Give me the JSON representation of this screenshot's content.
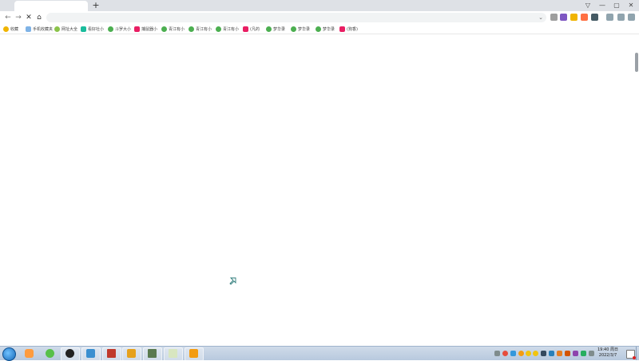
{
  "browser": {
    "new_tab_symbol": "+",
    "window_controls": {
      "shield": "▽",
      "minimize": "—",
      "maximize": "▢",
      "close": "✕"
    },
    "nav": {
      "back": "←",
      "forward": "→",
      "stop": "✕",
      "home": "⌂"
    },
    "address": {
      "value": "",
      "dropdown": "⌄"
    },
    "bookmarks": [
      {
        "label": "收藏",
        "icon": "star-icon",
        "color": "#f0b400"
      },
      {
        "label": "手机收藏夹",
        "icon": "phone-icon",
        "color": "#7fb3e6"
      },
      {
        "label": "网址大全",
        "icon": "globe-icon",
        "color": "#8bc34a"
      },
      {
        "label": "看好社小",
        "icon": "book-icon",
        "color": "#1abc9c"
      },
      {
        "label": "斗罗大小",
        "icon": "play-icon",
        "color": "#4caf50"
      },
      {
        "label": "捕鼠器小",
        "icon": "page-icon",
        "color": "#e91e63"
      },
      {
        "label": "青江有小",
        "icon": "play-icon",
        "color": "#4caf50"
      },
      {
        "label": "青江有小",
        "icon": "play-icon",
        "color": "#4caf50"
      },
      {
        "label": "青江有小",
        "icon": "play-icon",
        "color": "#4caf50"
      },
      {
        "label": "(凡的",
        "icon": "page-icon",
        "color": "#e91e63"
      },
      {
        "label": "梦华录",
        "icon": "play-icon",
        "color": "#4caf50"
      },
      {
        "label": "梦华录",
        "icon": "play-icon",
        "color": "#4caf50"
      },
      {
        "label": "梦华录",
        "icon": "play-icon",
        "color": "#4caf50"
      },
      {
        "label": "(狗香)",
        "icon": "page-icon",
        "color": "#e91e63"
      }
    ]
  },
  "taskbar": {
    "apps": [
      {
        "icon": "ie-icon",
        "color": "#ff9b3d"
      },
      {
        "icon": "360-browser-icon",
        "color": "#58c04a"
      },
      {
        "icon": "obs-icon",
        "color": "#222222"
      },
      {
        "icon": "file-manager-icon",
        "color": "#3a8fd0"
      },
      {
        "icon": "media-player-icon",
        "color": "#c0392b"
      },
      {
        "icon": "video-app-icon",
        "color": "#e6a11c"
      },
      {
        "icon": "game-icon",
        "color": "#5a7a4f"
      },
      {
        "icon": "notepad-icon",
        "color": "#d8e6c0"
      },
      {
        "icon": "help-icon",
        "color": "#f39c12"
      }
    ],
    "clock": {
      "time": "19:40 周日",
      "date": "2022/3/7"
    }
  }
}
